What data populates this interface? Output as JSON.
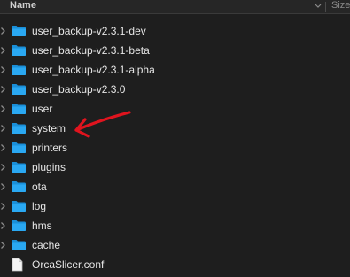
{
  "header": {
    "name_label": "Name",
    "size_label": "Size"
  },
  "items": [
    {
      "label": "user_backup-v2.3.1-dev",
      "kind": "folder"
    },
    {
      "label": "user_backup-v2.3.1-beta",
      "kind": "folder"
    },
    {
      "label": "user_backup-v2.3.1-alpha",
      "kind": "folder"
    },
    {
      "label": "user_backup-v2.3.0",
      "kind": "folder"
    },
    {
      "label": "user",
      "kind": "folder"
    },
    {
      "label": "system",
      "kind": "folder"
    },
    {
      "label": "printers",
      "kind": "folder"
    },
    {
      "label": "plugins",
      "kind": "folder"
    },
    {
      "label": "ota",
      "kind": "folder"
    },
    {
      "label": "log",
      "kind": "folder"
    },
    {
      "label": "hms",
      "kind": "folder"
    },
    {
      "label": "cache",
      "kind": "folder"
    },
    {
      "label": "OrcaSlicer.conf",
      "kind": "file"
    }
  ],
  "colors": {
    "background": "#1e1e1e",
    "folder": "#1ea1f2",
    "annotation": "#e0141e"
  }
}
